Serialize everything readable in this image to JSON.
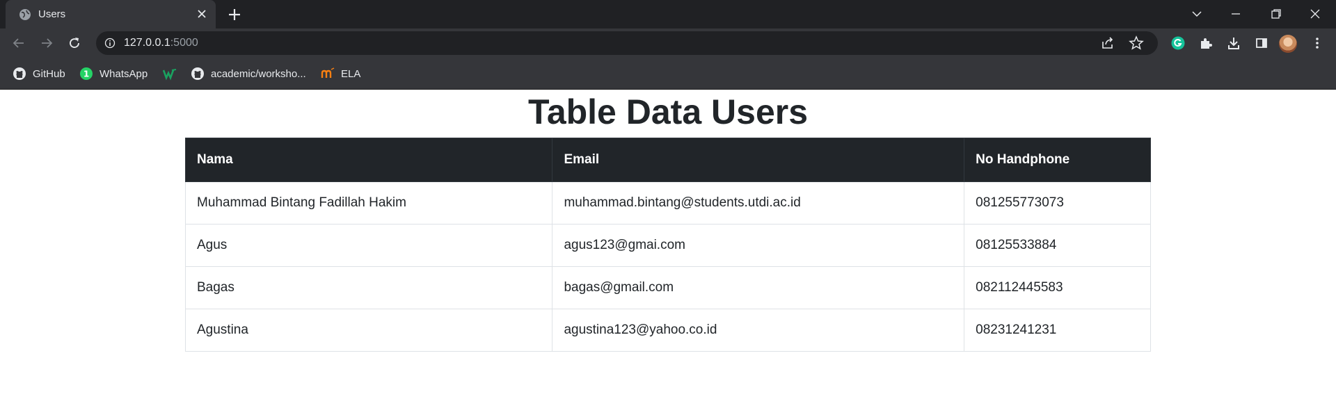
{
  "browser": {
    "tab_title": "Users",
    "url_host": "127.0.0.1",
    "url_port": ":5000",
    "bookmarks": [
      {
        "label": "GitHub",
        "icon": "github-icon"
      },
      {
        "label": "WhatsApp",
        "icon": "whatsapp-icon"
      },
      {
        "label": "",
        "icon": "w-logo-icon"
      },
      {
        "label": "academic/worksho...",
        "icon": "github-icon"
      },
      {
        "label": "ELA",
        "icon": "ela-logo-icon"
      }
    ],
    "whatsapp_badge": "1"
  },
  "page": {
    "title": "Table Data Users",
    "columns": [
      "Nama",
      "Email",
      "No Handphone"
    ],
    "rows": [
      [
        "Muhammad Bintang Fadillah Hakim",
        "muhammad.bintang@students.utdi.ac.id",
        "081255773073"
      ],
      [
        "Agus",
        "agus123@gmai.com",
        "08125533884"
      ],
      [
        "Bagas",
        "bagas@gmail.com",
        "082112445583"
      ],
      [
        "Agustina",
        "agustina123@yahoo.co.id",
        "08231241231"
      ]
    ]
  },
  "colors": {
    "chrome_dark": "#202124",
    "chrome_toolbar": "#35363a",
    "table_header": "#212529",
    "grammarly": "#15c39a"
  }
}
